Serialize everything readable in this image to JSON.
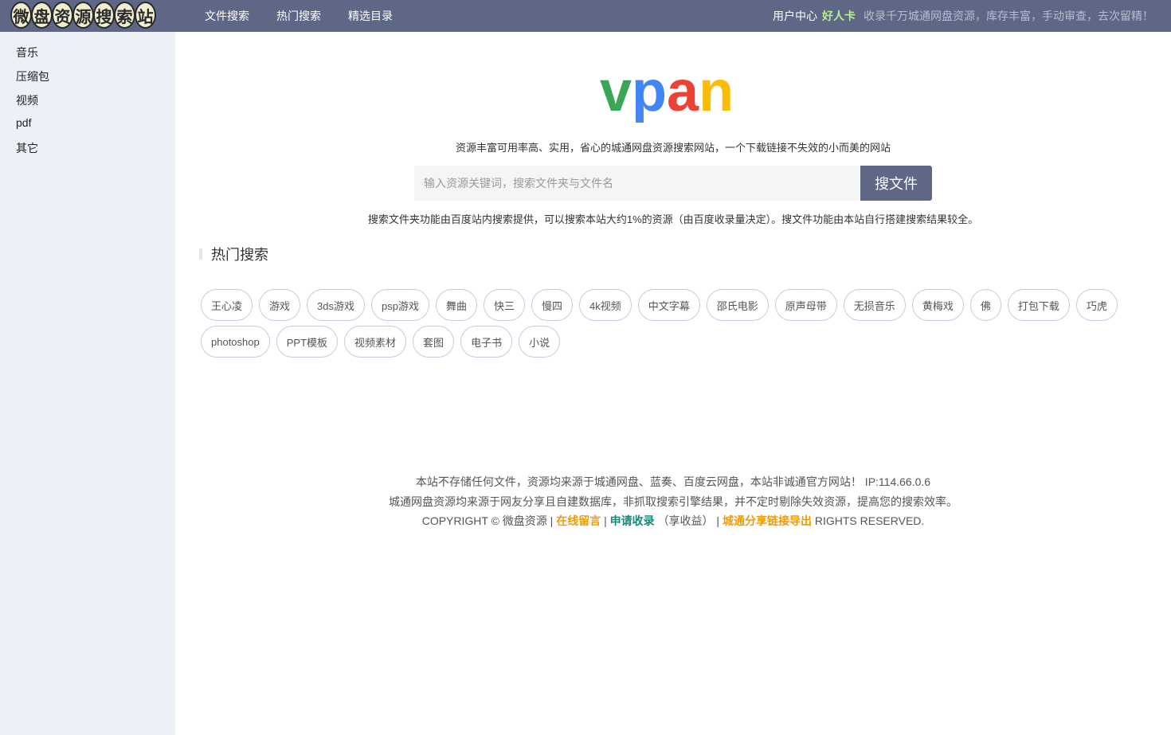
{
  "header": {
    "logo_chars": [
      "微",
      "盘",
      "资",
      "源",
      "搜",
      "索",
      "站"
    ],
    "nav": [
      "文件搜索",
      "热门搜索",
      "精选目录"
    ],
    "user_center": "用户中心",
    "good_card": "好人卡",
    "notice": "收录千万城通网盘资源，库存丰富，手动审查，去次留精！"
  },
  "sidebar": {
    "items": [
      "音乐",
      "压缩包",
      "视频",
      "pdf",
      "其它"
    ]
  },
  "brand": {
    "letters": [
      "v",
      "p",
      "a",
      "n"
    ],
    "colors": [
      "#3aa757",
      "#4285f4",
      "#ea4335",
      "#fbbc05"
    ]
  },
  "tagline": "资源丰富可用率高、实用，省心的城通网盘资源搜索网站，一个下载链接不失效的小而美的网站",
  "search": {
    "placeholder": "输入资源关键词，搜索文件夹与文件名",
    "button": "搜文件",
    "note": "搜索文件夹功能由百度站内搜索提供，可以搜索本站大约1%的资源（由百度收录量决定）。搜文件功能由本站自行搭建搜索结果较全。"
  },
  "hot": {
    "title": "热门搜索",
    "tags": [
      "王心凌",
      "游戏",
      "3ds游戏",
      "psp游戏",
      "舞曲",
      "快三",
      "慢四",
      "4k视频",
      "中文字幕",
      "邵氏电影",
      "原声母带",
      "无损音乐",
      "黄梅戏",
      "佛",
      "打包下载",
      "巧虎",
      "photoshop",
      "PPT模板",
      "视频素材",
      "套图",
      "电子书",
      "小说"
    ]
  },
  "footer": {
    "line1": "本站不存储任何文件，资源均来源于城通网盘、蓝奏、百度云网盘，本站非诚通官方网站！ IP:114.66.0.6",
    "line2": "城通网盘资源均来源于网友分享且自建数据库，非抓取搜索引擎结果，并不定时剔除失效资源，提高您的搜索效率。",
    "copyright_prefix": "COPYRIGHT © 微盘资源 |",
    "link_message": "在线留言",
    "sep1": "|",
    "link_apply": "申请收录",
    "apply_note": "（享收益） |",
    "link_export": "城通分享链接导出",
    "rights": "RIGHTS RESERVED."
  },
  "colors": {
    "topbar": "#5f6787",
    "sidebar": "#eef0f7",
    "accent_orange": "#f29a00",
    "accent_teal": "#138a7a",
    "good_card": "#b6f08a"
  }
}
